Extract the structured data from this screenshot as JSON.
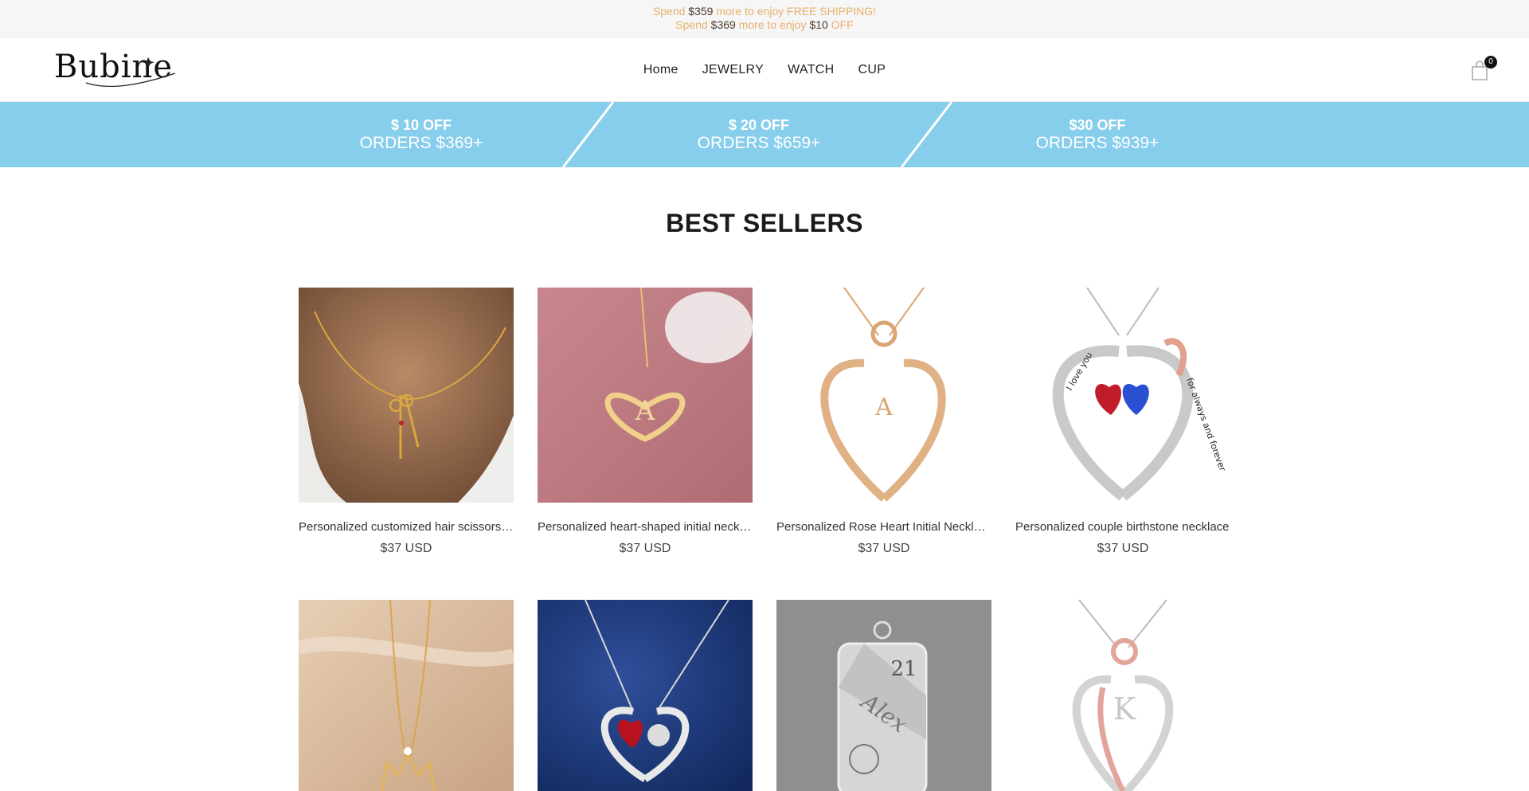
{
  "announcement": {
    "line1": {
      "pre": "Spend ",
      "amount": "$359",
      "post": " more to enjoy FREE SHIPPING!"
    },
    "line2": {
      "pre": "Spend ",
      "amount": "$369",
      "mid": " more to enjoy ",
      "amount2": "$10",
      "post": " OFF"
    }
  },
  "header": {
    "logo_text": "Bubine",
    "nav": [
      "Home",
      "JEWELRY",
      "WATCH",
      "CUP"
    ],
    "cart_count": "0"
  },
  "promo": [
    {
      "line1": "$ 10 OFF",
      "line2": "ORDERS $369+"
    },
    {
      "line1": "$ 20 OFF",
      "line2": "ORDERS $659+"
    },
    {
      "line1": "$30 OFF",
      "line2": "ORDERS $939+"
    }
  ],
  "best_sellers": {
    "title": "BEST SELLERS",
    "products": [
      {
        "title": "Personalized customized hair scissors necklace",
        "price": "$37 USD"
      },
      {
        "title": "Personalized heart-shaped initial necklace",
        "price": "$37 USD"
      },
      {
        "title": "Personalized Rose Heart Initial Necklace",
        "price": "$37 USD"
      },
      {
        "title": "Personalized couple birthstone necklace",
        "price": "$37 USD"
      },
      {
        "title": "",
        "price": ""
      },
      {
        "title": "",
        "price": ""
      },
      {
        "title": "",
        "price": ""
      },
      {
        "title": "",
        "price": ""
      }
    ],
    "engraving": {
      "heart_left": "I love you",
      "heart_right": "for always and forever",
      "tag_number": "21",
      "tag_name": "Alex",
      "initial_a": "A",
      "initial_k": "K"
    }
  },
  "colors": {
    "promo_band": "#87cdec",
    "announce_text": "#e8b06a",
    "announce_bg": "#f6f6f6"
  }
}
